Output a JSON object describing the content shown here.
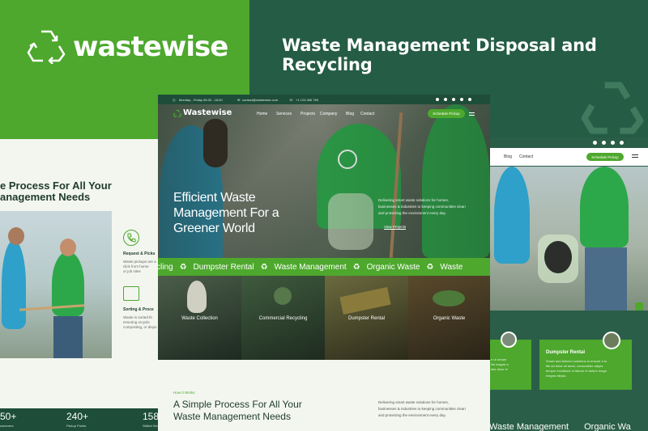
{
  "brand": {
    "name": "wastewise"
  },
  "hero_title": "Waste Management Disposal and Recycling",
  "left_card": {
    "title_line1": "e Process For All Your",
    "title_line2": "anagement Needs",
    "step1_title": "Request & Picku",
    "step1_text": [
      "Waste pickups are a",
      "click from home",
      "or job sites"
    ],
    "step2_title": "Sorting & Proce",
    "step2_text": [
      "Waste is sorted th",
      "ensuring recycle",
      "composting, or dispo"
    ],
    "stats": [
      {
        "value": "50+",
        "label": "ustomers"
      },
      {
        "value": "240+",
        "label": "Pickup Points"
      },
      {
        "value": "158",
        "label": "Skilled Wo"
      }
    ]
  },
  "main": {
    "topbar": {
      "hours": "Monday - Friday 08.00 - 18.00",
      "email": "contact@wastewise.com",
      "phone": "+1 123 456 789"
    },
    "nav": {
      "logo": "Wastewise",
      "items": [
        "Home",
        "Services",
        "Projects",
        "Company",
        "Blog",
        "Contact"
      ],
      "cta": "Schedule Pickup"
    },
    "hero": {
      "heading_line1": "Efficient Waste",
      "heading_line2": "Management For a",
      "heading_line3": "Greener World",
      "desc_line1": "Delivering smart waste solutions for homes,",
      "desc_line2": "businesses & industries to keeping communities clean",
      "desc_line3": "and protecting the environment every day.",
      "cta": "View Projects"
    },
    "ticker": [
      "cling",
      "Dumpster Rental",
      "Waste Management",
      "Organic Waste",
      "Waste"
    ],
    "tiles": [
      "Waste Collection",
      "Commercial Recycling",
      "Dumpster Rental",
      "Organic Waste"
    ],
    "how": {
      "eyebrow": "How It Works",
      "title_line1": "A Simple Process For All Your",
      "title_line2": "Waste Management Needs",
      "desc_line1": "Delivering smart waste solutions for homes,",
      "desc_line2": "businesses & industries to keeping communities clean",
      "desc_line3": "and protecting the environment every day."
    }
  },
  "right_card": {
    "nav_items": [
      "Blog",
      "Contact"
    ],
    "cta": "Schedule Pickup",
    "service_title": "Dumpster Rental",
    "service_text": [
      "Smart and tailored solutions to ensure a tu",
      "tile ad dolor sit amet, consectetur adipis",
      "tempor incididunt ut labore et dolore magn",
      "magna aliqua."
    ],
    "left_text": [
      "n ut ornare",
      "ilia magna a",
      "tate dolor tv"
    ],
    "ticker": [
      "Waste Management",
      "Organic Wa"
    ]
  },
  "colors": {
    "green": "#4da82d",
    "dark": "#1e4d3a",
    "mid": "#245c45"
  },
  "icons": [
    "recycle-icon",
    "phone-icon",
    "mail-icon",
    "clock-icon",
    "menu-icon",
    "arrow-icon"
  ]
}
